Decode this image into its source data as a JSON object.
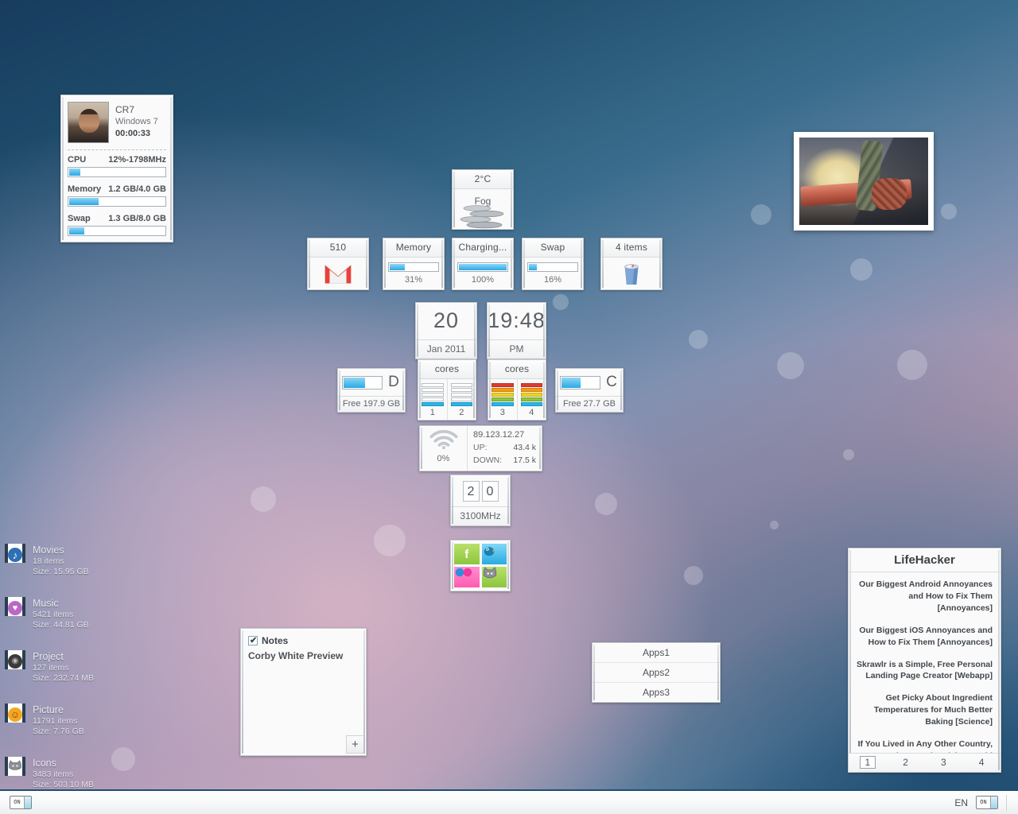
{
  "desktop": {
    "background_colors": {
      "top_left": "#173c5e",
      "mid_mauve": "#c9a7bd",
      "right_blue": "#3f7296"
    }
  },
  "sysmon": {
    "user": "CR7",
    "os": "Windows 7",
    "uptime": "00:00:33",
    "avatar_name": "user-avatar",
    "rows": [
      {
        "label": "CPU",
        "value": "12%-1798MHz",
        "fill": 12
      },
      {
        "label": "Memory",
        "value": "1.2 GB/4.0 GB",
        "fill": 31
      },
      {
        "label": "Swap",
        "value": "1.3 GB/8.0 GB",
        "fill": 16
      }
    ]
  },
  "weather": {
    "temp": "2°C",
    "condition": "Fog"
  },
  "gadgets": {
    "gmail": {
      "count": "510"
    },
    "memory": {
      "title": "Memory",
      "pct": "31%",
      "fill": 31
    },
    "battery": {
      "title": "Charging...",
      "pct": "100%",
      "fill": 100
    },
    "swap": {
      "title": "Swap",
      "pct": "16%",
      "fill": 16
    },
    "trash": {
      "title": "4 items"
    }
  },
  "date": {
    "day": "20",
    "monthyear": "Jan 2011"
  },
  "clock": {
    "time": "19:48",
    "meridiem": "PM"
  },
  "disks": [
    {
      "letter": "D",
      "free": "Free 197.9 GB",
      "fill": 58
    },
    {
      "letter": "C",
      "free": "Free 27.7 GB",
      "fill": 52
    }
  ],
  "cores": {
    "title": "cores",
    "group1": [
      {
        "num": "1",
        "level": 1
      },
      {
        "num": "2",
        "level": 1
      }
    ],
    "group2": [
      {
        "num": "3",
        "level": 5
      },
      {
        "num": "4",
        "level": 5
      }
    ]
  },
  "network": {
    "ip": "89.123.12.27",
    "usage_pct": "0%",
    "up_label": "UP:",
    "up_value": "43.4 k",
    "down_label": "DOWN:",
    "down_value": "17.5 k"
  },
  "cpufreq": {
    "digits": [
      "2",
      "0"
    ],
    "freq": "3100MHz"
  },
  "social": [
    {
      "name": "facebook-icon",
      "glyph": "f"
    },
    {
      "name": "twitter-icon",
      "glyph": "t"
    },
    {
      "name": "flickr-icon",
      "glyph": "●●"
    },
    {
      "name": "cat-icon",
      "glyph": "ὃ1"
    }
  ],
  "notes": {
    "title": "Notes",
    "text": "Corby White Preview",
    "add_label": "+"
  },
  "apps": {
    "items": [
      "Apps1",
      "Apps2",
      "Apps3"
    ]
  },
  "lifehacker": {
    "title": "LifeHacker",
    "headlines": [
      "Our Biggest Android Annoyances and How to Fix Them [Annoyances]",
      "Our Biggest iOS Annoyances and How to Fix Them [Annoyances]",
      "Skrawlr is a Simple, Free Personal Landing Page Creator [Webapp]",
      "Get Picky About Ingredient Temperatures for Much Better Baking [Science]",
      "If You Lived in Any Other Country, How Much Less Electricity Would You Use? [Websites]"
    ],
    "pages": [
      "1",
      "2",
      "3",
      "4"
    ],
    "current_page": "1"
  },
  "folders": [
    {
      "name": "Movies",
      "items": "18 items",
      "size": "Size: 15.95 GB",
      "icon": "music-note-icon",
      "glyph": "♪",
      "color": "#2f6fb5"
    },
    {
      "name": "Music",
      "items": "5421 items",
      "size": "Size: 44.81 GB",
      "icon": "heart-disc-icon",
      "glyph": "♥",
      "color": "#b968c7"
    },
    {
      "name": "Project",
      "items": "127 items",
      "size": "Size: 232.74 MB",
      "icon": "disc-icon",
      "glyph": "◉",
      "color": "#3a3a3a"
    },
    {
      "name": "Picture",
      "items": "11791 items",
      "size": "Size: 7.76 GB",
      "icon": "smiley-icon",
      "glyph": "☺",
      "color": "#f5a623"
    },
    {
      "name": "Icons",
      "items": "3483 items",
      "size": "Size: 503.10 MB",
      "icon": "cat-icon",
      "glyph": "◔",
      "color": "#8a8a8a"
    }
  ],
  "taskbar": {
    "toggle_label": "ON",
    "language": "EN"
  }
}
